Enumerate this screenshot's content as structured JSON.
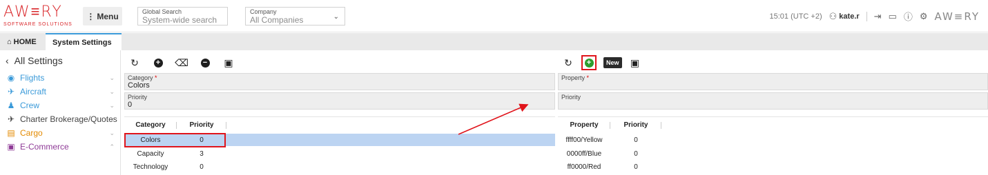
{
  "header": {
    "logo_main": "AW≡RY",
    "logo_sub": "SOFTWARE SOLUTIONS",
    "menu_label": "Menu",
    "global_search": {
      "label": "Global Search",
      "placeholder": "System-wide search"
    },
    "company": {
      "label": "Company",
      "value": "All Companies"
    },
    "time": "15:01 (UTC +2)",
    "user": "kate.r",
    "logo_right": "AW≡RY"
  },
  "tabs": [
    {
      "label": "HOME"
    },
    {
      "label": "System Settings"
    }
  ],
  "sidebar": {
    "back_label": "All Settings",
    "items": [
      {
        "label": "Flights",
        "color": "#3a9ad9",
        "icon": "globe-icon"
      },
      {
        "label": "Aircraft",
        "color": "#3a9ad9",
        "icon": "plane-icon"
      },
      {
        "label": "Crew",
        "color": "#3a9ad9",
        "icon": "person-icon"
      },
      {
        "label": "Charter Brokerage/Quotes",
        "color": "#444444",
        "icon": "takeoff-icon"
      },
      {
        "label": "Cargo",
        "color": "#e38a00",
        "icon": "warehouse-icon"
      },
      {
        "label": "E-Commerce",
        "color": "#8e3a96",
        "icon": "money-icon"
      }
    ]
  },
  "left_panel": {
    "category_field": {
      "label": "Category",
      "required": "*",
      "value": "Colors"
    },
    "priority_field": {
      "label": "Priority",
      "value": "0"
    },
    "columns": [
      "Category",
      "Priority"
    ],
    "rows": [
      {
        "category": "Colors",
        "priority": "0"
      },
      {
        "category": "Capacity",
        "priority": "3"
      },
      {
        "category": "Technology",
        "priority": "0"
      }
    ]
  },
  "right_panel": {
    "new_label": "New",
    "property_field": {
      "label": "Property",
      "required": "*",
      "value": ""
    },
    "priority_field": {
      "label": "Priority",
      "value": ""
    },
    "columns": [
      "Property",
      "Priority"
    ],
    "rows": [
      {
        "property": "ffff00/Yellow",
        "priority": "0"
      },
      {
        "property": "0000ff/Blue",
        "priority": "0"
      },
      {
        "property": "ff0000/Red",
        "priority": "0"
      }
    ]
  },
  "colors": {
    "accent": "#3a9ad9",
    "highlight": "#e0141b",
    "selected_row": "#bcd4f2",
    "add_button": "#2e9d2e"
  }
}
